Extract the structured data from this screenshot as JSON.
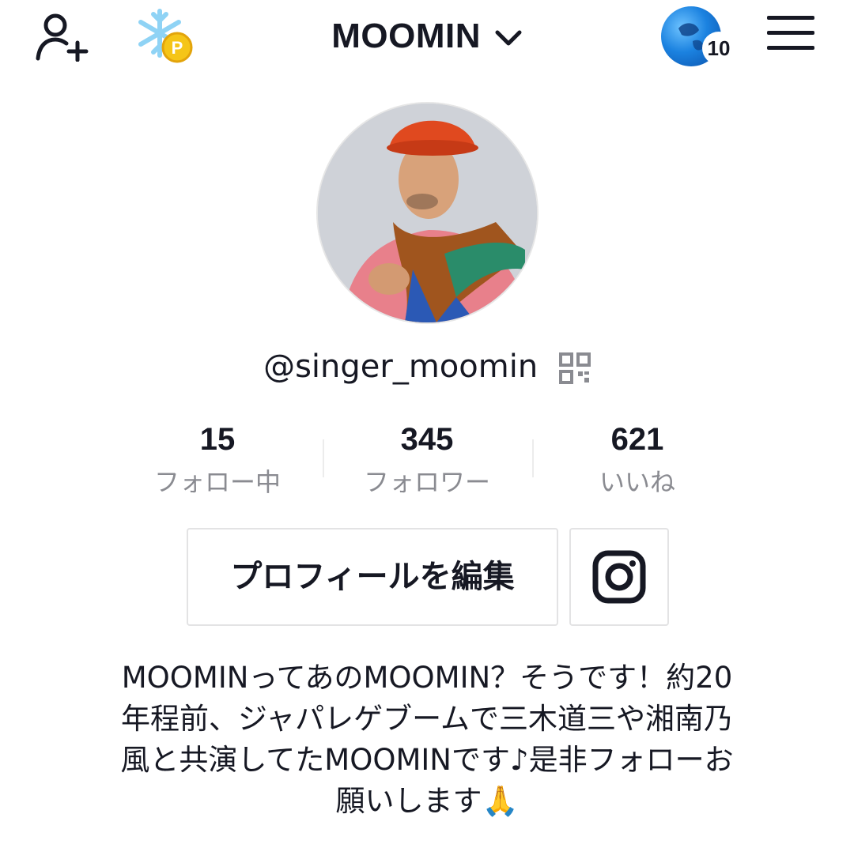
{
  "header": {
    "account_name": "MOOMIN",
    "notification_count": "10",
    "icons": [
      "add-user-icon",
      "coin-snowflake-icon",
      "chevron-down-icon",
      "notification-avatar",
      "menu-icon"
    ]
  },
  "profile": {
    "username": "@singer_moomin"
  },
  "stats": [
    {
      "value": "15",
      "label": "フォロー中"
    },
    {
      "value": "345",
      "label": "フォロワー"
    },
    {
      "value": "621",
      "label": "いいね"
    }
  ],
  "actions": {
    "edit_profile_label": "プロフィールを編集"
  },
  "bio": {
    "lines": [
      "MOOMINってあのMOOMIN？そうです！約20",
      "年程前、ジャパレゲブームで三木道三や湘南乃",
      "風と共演してたMOOMINです♪是非フォローお",
      "願いします🙏"
    ]
  },
  "colors": {
    "text": "#161823",
    "muted": "#8a8b91",
    "border": "#e3e3e4"
  }
}
